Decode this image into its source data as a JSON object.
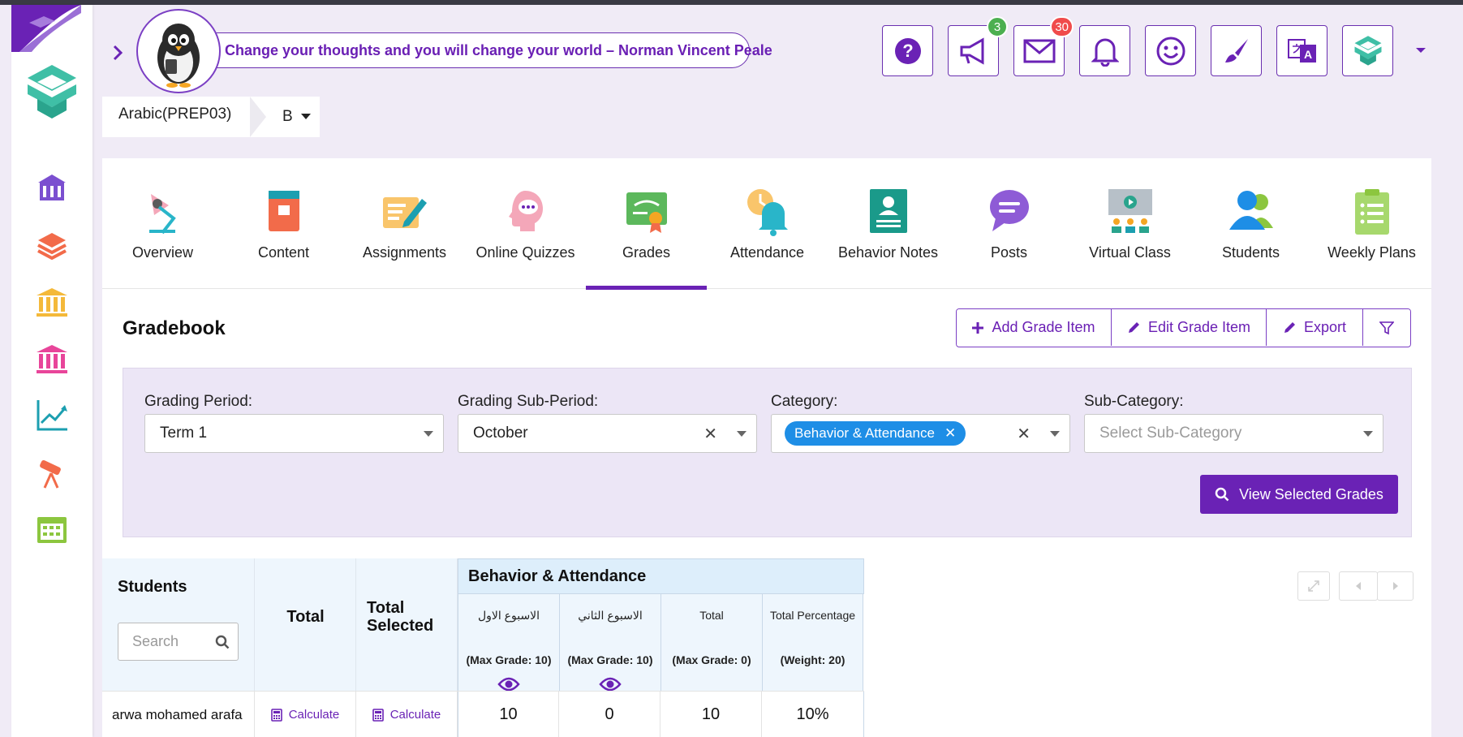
{
  "header": {
    "quote": "Change your thoughts and you will change your world – Norman Vincent Peale",
    "buttons": [
      {
        "name": "help-icon"
      },
      {
        "name": "megaphone-icon",
        "badge": "3",
        "badge_color": "#4caf50"
      },
      {
        "name": "mail-icon",
        "badge": "30",
        "badge_color": "#f04b4b"
      },
      {
        "name": "bell-icon"
      },
      {
        "name": "smiley-icon"
      },
      {
        "name": "brush-icon"
      },
      {
        "name": "translate-icon"
      },
      {
        "name": "app-logo-icon"
      }
    ]
  },
  "course": {
    "name": "Arabic(PREP03)",
    "section": "B"
  },
  "tabs": [
    {
      "label": "Overview",
      "icon": "lamp-icon"
    },
    {
      "label": "Content",
      "icon": "book-icon"
    },
    {
      "label": "Assignments",
      "icon": "assignment-icon"
    },
    {
      "label": "Online Quizzes",
      "icon": "quiz-head-icon"
    },
    {
      "label": "Grades",
      "icon": "certificate-icon",
      "active": true
    },
    {
      "label": "Attendance",
      "icon": "alarm-bell-icon"
    },
    {
      "label": "Behavior Notes",
      "icon": "id-card-icon"
    },
    {
      "label": "Posts",
      "icon": "chat-bubble-icon"
    },
    {
      "label": "Virtual Class",
      "icon": "presentation-icon"
    },
    {
      "label": "Students",
      "icon": "users-icon"
    },
    {
      "label": "Weekly Plans",
      "icon": "clipboard-list-icon"
    }
  ],
  "gradebook": {
    "title": "Gradebook",
    "toolbar": {
      "add": "Add Grade Item",
      "edit": "Edit Grade Item",
      "export": "Export"
    },
    "filters": {
      "period_label": "Grading Period:",
      "period_value": "Term 1",
      "subperiod_label": "Grading Sub-Period:",
      "subperiod_value": "October",
      "category_label": "Category:",
      "category_chip": "Behavior & Attendance",
      "subcategory_label": "Sub-Category:",
      "subcategory_placeholder": "Select Sub-Category",
      "view_button": "View Selected Grades"
    },
    "table": {
      "students_header": "Students",
      "search_placeholder": "Search",
      "total_header": "Total",
      "total_selected_header": "Total Selected",
      "group_header": "Behavior & Attendance",
      "subcolumns": [
        {
          "title": "الاسبوع الاول",
          "meta": "(Max Grade: 10)",
          "eye": true
        },
        {
          "title": "الاسبوع الثاني",
          "meta": "(Max Grade: 10)",
          "eye": true
        },
        {
          "title": "Total",
          "meta": "(Max Grade: 0)",
          "eye": false
        },
        {
          "title": "Total Percentage",
          "meta": "(Weight: 20)",
          "eye": false
        }
      ],
      "rows": [
        {
          "student": "arwa mohamed arafa",
          "total": "Calculate",
          "total_selected": "Calculate",
          "values": [
            "10",
            "0",
            "10",
            "10%"
          ]
        }
      ]
    }
  },
  "colors": {
    "brand_purple": "#6a22b5",
    "chip_blue": "#1e8ee6",
    "panel_bg": "#ece6f6"
  }
}
